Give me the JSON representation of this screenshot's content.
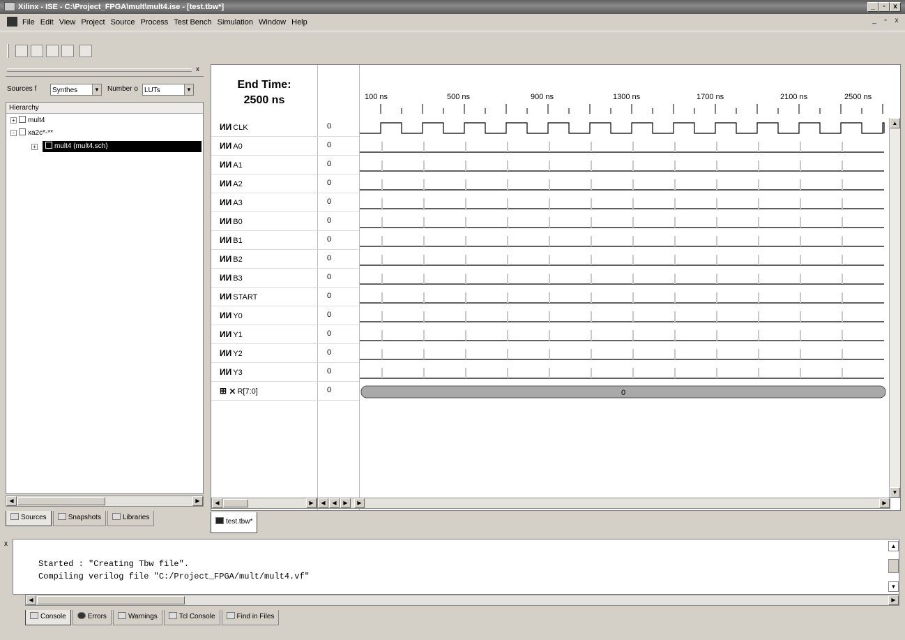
{
  "window": {
    "title": "Xilinx - ISE - C:\\Project_FPGA\\mult\\mult4.ise - [test.tbw*]",
    "controls": [
      "_",
      "ʘ",
      "x"
    ]
  },
  "menu": [
    "File",
    "Edit",
    "View",
    "Project",
    "Source",
    "Process",
    "Test Bench",
    "Simulation",
    "Window",
    "Help"
  ],
  "toolbar": {
    "icons": [
      "new-file-icon",
      "open-file-icon",
      "save-icon",
      "save-all-icon",
      "wizard-icon"
    ]
  },
  "sources": {
    "label_sources": "Sources f",
    "combo_synth": "Synthes",
    "label_number": "Number o",
    "combo_luts": "LUTs",
    "hierarchy_header": "Hierarchy",
    "nodes": [
      {
        "label": "mult4",
        "expander": "+"
      },
      {
        "label": "xa2c*-**",
        "expander": "-"
      },
      {
        "label": "mult4 (mult4.sch)",
        "expander": "+",
        "selected": true
      }
    ],
    "tabs": [
      "Sources",
      "Snapshots",
      "Libraries"
    ]
  },
  "waveform": {
    "end_time_label": "End Time:",
    "end_time_value": "2500 ns",
    "time_ticks": [
      "100 ns",
      "500 ns",
      "900 ns",
      "1300 ns",
      "1700 ns",
      "2100 ns",
      "2500 ns"
    ],
    "signals": [
      {
        "name": "CLK",
        "value": "0",
        "kind": "input",
        "clock": true
      },
      {
        "name": "A0",
        "value": "0",
        "kind": "input"
      },
      {
        "name": "A1",
        "value": "0",
        "kind": "input"
      },
      {
        "name": "A2",
        "value": "0",
        "kind": "input"
      },
      {
        "name": "A3",
        "value": "0",
        "kind": "input"
      },
      {
        "name": "B0",
        "value": "0",
        "kind": "input"
      },
      {
        "name": "B1",
        "value": "0",
        "kind": "input"
      },
      {
        "name": "B2",
        "value": "0",
        "kind": "input"
      },
      {
        "name": "B3",
        "value": "0",
        "kind": "input"
      },
      {
        "name": "START",
        "value": "0",
        "kind": "input"
      },
      {
        "name": "Y0",
        "value": "0",
        "kind": "output"
      },
      {
        "name": "Y1",
        "value": "0",
        "kind": "output"
      },
      {
        "name": "Y2",
        "value": "0",
        "kind": "output"
      },
      {
        "name": "Y3",
        "value": "0",
        "kind": "output"
      },
      {
        "name": "R[7:0]",
        "value": "0",
        "kind": "bus",
        "bus_value": "0"
      }
    ],
    "doc_tab": "test.tbw*"
  },
  "console": {
    "lines": [
      "Started : \"Creating Tbw file\".",
      "Compiling verilog file \"C:/Project_FPGA/mult/mult4.vf\""
    ],
    "tabs": [
      "Console",
      "Errors",
      "Warnings",
      "Tcl Console",
      "Find in Files"
    ]
  }
}
